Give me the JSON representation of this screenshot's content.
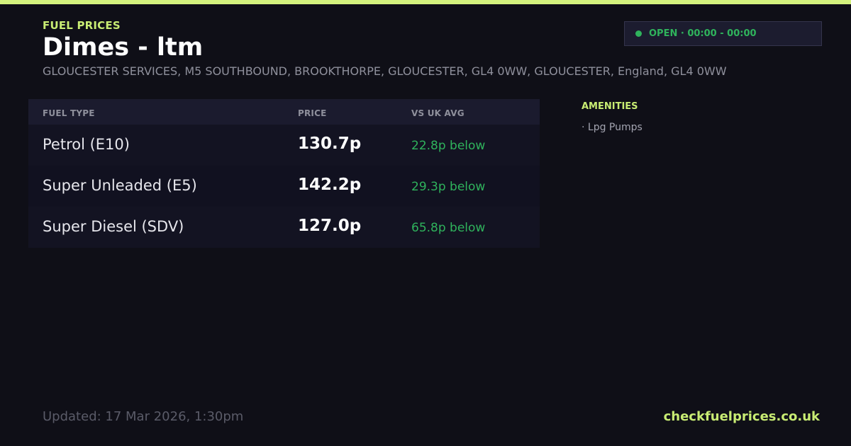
{
  "header": {
    "eyebrow": "FUEL PRICES",
    "title": "Dimes - ltm",
    "address": "GLOUCESTER SERVICES, M5 SOUTHBOUND, BROOKTHORPE, GLOUCESTER, GL4 0WW, GLOUCESTER, England, GL4 0WW"
  },
  "status": {
    "label": "OPEN · 00:00 - 00:00",
    "color": "#2fb35c"
  },
  "table": {
    "columns": [
      "FUEL TYPE",
      "PRICE",
      "VS UK AVG"
    ],
    "rows": [
      {
        "fuel": "Petrol (E10)",
        "price": "130.7p",
        "diff": "22.8p below"
      },
      {
        "fuel": "Super Unleaded (E5)",
        "price": "142.2p",
        "diff": "29.3p below"
      },
      {
        "fuel": "Super Diesel (SDV)",
        "price": "127.0p",
        "diff": "65.8p below"
      }
    ]
  },
  "amenities": {
    "title": "AMENITIES",
    "items": [
      "· Lpg Pumps"
    ]
  },
  "footer": {
    "updated": "Updated: 17 Mar 2026, 1:30pm",
    "site": "checkfuelprices.co.uk"
  },
  "colors": {
    "accent": "#c8ec73",
    "background": "#0f0f17",
    "positive": "#2fb35c"
  }
}
